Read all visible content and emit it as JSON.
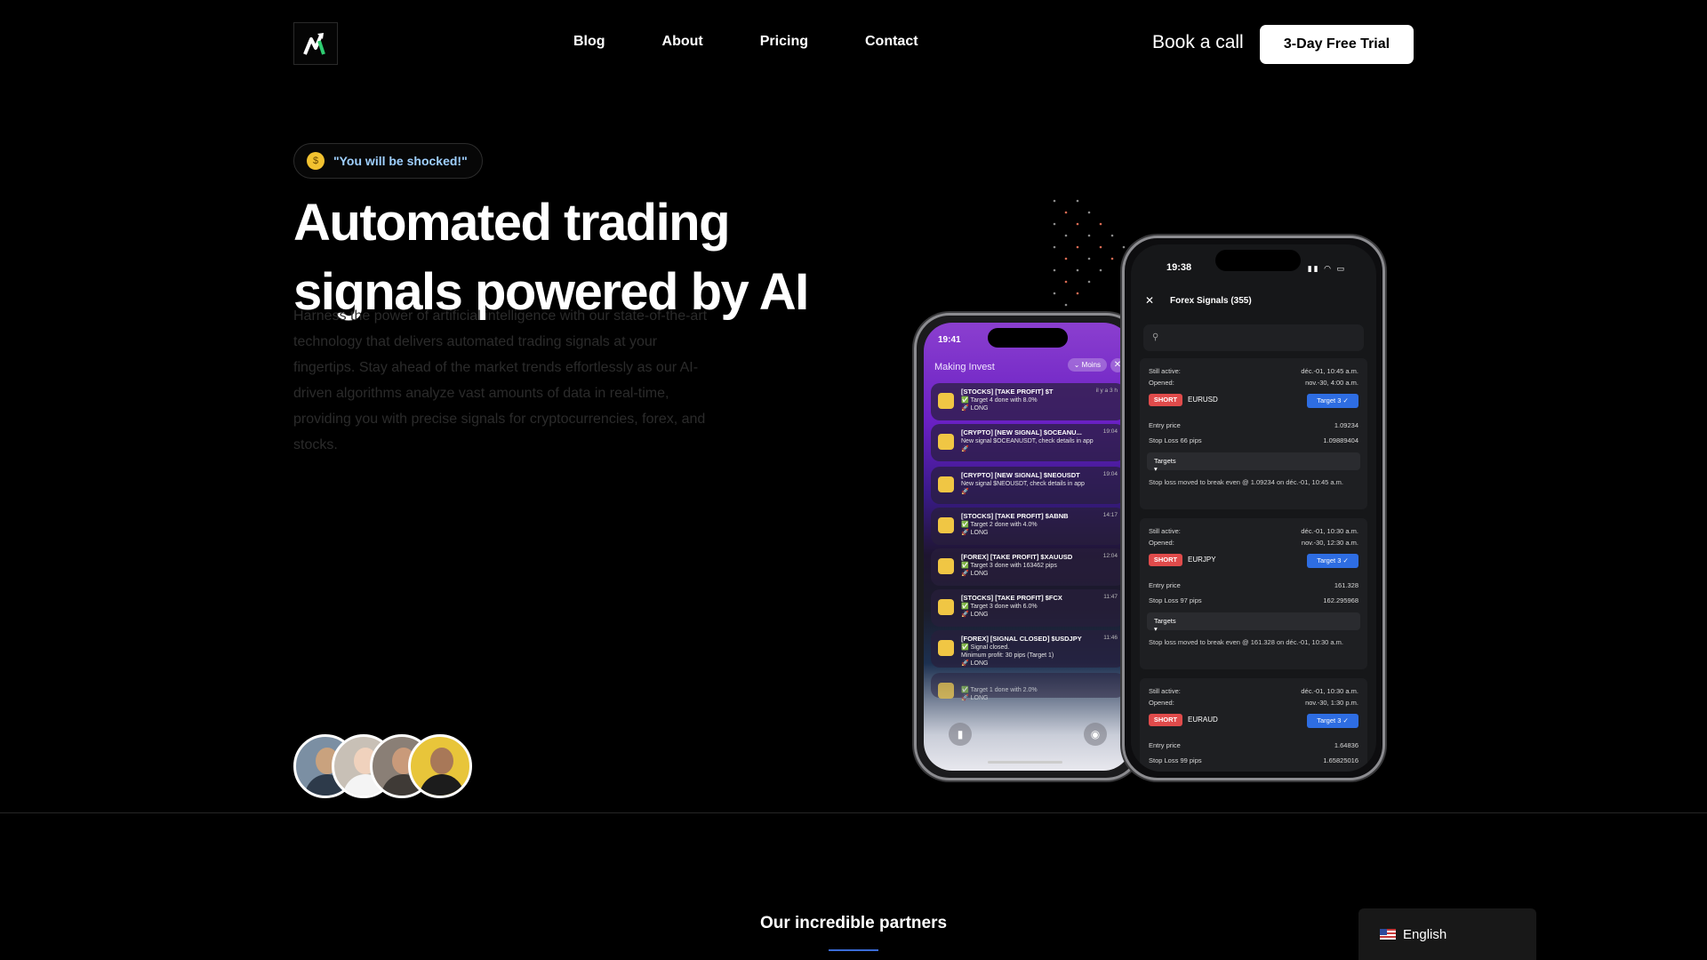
{
  "header": {
    "nav": [
      "Blog",
      "About",
      "Pricing",
      "Contact"
    ],
    "book_call": "Book a call",
    "trial_button": "3-Day Free Trial"
  },
  "hero": {
    "pill_emoji": "🤑",
    "pill_text": "\"You will be shocked!\"",
    "title_line1": "Automated trading",
    "title_line2": "signals powered by AI",
    "description": "Harness the power of artificial intelligence with our state-of-the-art technology that delivers automated trading signals at your fingertips. Stay ahead of the market trends effortlessly as our AI-driven algorithms analyze vast amounts of data in real-time, providing you with precise signals for cryptocurrencies, forex, and stocks."
  },
  "avatars": [
    {
      "name": "avatar-1",
      "skin": "#c9a27e",
      "shirt": "#2d3a4a",
      "bg": "#7b8fa3"
    },
    {
      "name": "avatar-2",
      "skin": "#f0d2bd",
      "shirt": "#f4f4f4",
      "bg": "#c8c0b6"
    },
    {
      "name": "avatar-3",
      "skin": "#c99a7a",
      "shirt": "#3f3a36",
      "bg": "#8a7f76"
    },
    {
      "name": "avatar-4",
      "skin": "#a87858",
      "shirt": "#1c1c1c",
      "bg": "#e8c53a"
    }
  ],
  "partners": {
    "title": "Our incredible partners"
  },
  "language": {
    "label": "English"
  },
  "phone_left": {
    "time": "19:41",
    "app_name": "Making Invest",
    "more_label": "⌄ Moins",
    "notifications": [
      {
        "title": "[STOCKS] [TAKE PROFIT] $T",
        "body": "✅ Target 4 done with 8.0%\n🚀 LONG",
        "time": "il y a 3 h"
      },
      {
        "title": "[CRYPTO] [NEW SIGNAL] $OCEANU...",
        "body": "New signal $OCEANUSDT, check details in app\n🚀",
        "time": "19:04"
      },
      {
        "title": "[CRYPTO] [NEW SIGNAL] $NEOUSDT",
        "body": "New signal $NEOUSDT, check details in app\n🚀",
        "time": "19:04"
      },
      {
        "title": "[STOCKS] [TAKE PROFIT] $ABNB",
        "body": "✅ Target 2 done with 4.0%\n🚀 LONG",
        "time": "14:17"
      },
      {
        "title": "[FOREX] [TAKE PROFIT] $XAUUSD",
        "body": "✅ Target 3 done with 163462 pips\n🚀 LONG",
        "time": "12:04"
      },
      {
        "title": "[STOCKS] [TAKE PROFIT] $FCX",
        "body": "✅ Target 3 done with 6.0%\n🚀 LONG",
        "time": "11:47"
      },
      {
        "title": "[FOREX] [SIGNAL CLOSED] $USDJPY",
        "body": "✅ Signal closed.\nMinimum profit: 30 pips (Target 1)\n🚀 LONG",
        "time": "11:46"
      },
      {
        "title": "",
        "body": "✅ Target 1 done with 2.0%\n🚀 LONG",
        "time": ""
      }
    ]
  },
  "phone_right": {
    "time": "19:38",
    "title": "Forex Signals (355)",
    "cards": [
      {
        "active": "déc.-01, 10:45 a.m.",
        "opened": "nov.-30, 4:00 a.m.",
        "pair": "EURUSD",
        "entry": "1.09234",
        "stop_label": "Stop Loss 66 pips",
        "stop": "1.09889404",
        "note": "Stop loss moved to break even @ 1.09234 on déc.-01, 10:45 a.m."
      },
      {
        "active": "déc.-01, 10:30 a.m.",
        "opened": "nov.-30, 12:30 a.m.",
        "pair": "EURJPY",
        "entry": "161.328",
        "stop_label": "Stop Loss 97 pips",
        "stop": "162.295968",
        "note": "Stop loss moved to break even @ 161.328 on déc.-01, 10:30 a.m."
      },
      {
        "active": "déc.-01, 10:30 a.m.",
        "opened": "nov.-30, 1:30 p.m.",
        "pair": "EURAUD",
        "entry": "1.64836",
        "stop_label": "Stop Loss 99 pips",
        "stop": "1.65825016",
        "note": ""
      }
    ],
    "labels": {
      "still_active": "Still active:",
      "opened": "Opened:",
      "short": "SHORT",
      "target": "Target 3 ✓",
      "entry_price": "Entry price",
      "targets": "Targets"
    }
  }
}
